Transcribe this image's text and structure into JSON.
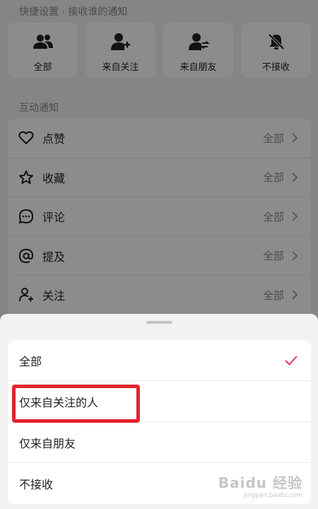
{
  "quick_settings": {
    "title": "快捷设置 · 接收谁的通知",
    "cards": [
      {
        "label": "全部",
        "icon": "group-icon"
      },
      {
        "label": "来自关注",
        "icon": "user-plus-icon"
      },
      {
        "label": "来自朋友",
        "icon": "user-friends-icon"
      },
      {
        "label": "不接收",
        "icon": "bell-off-icon"
      }
    ]
  },
  "interaction": {
    "title": "互动通知",
    "rows": [
      {
        "label": "点赞",
        "value": "全部",
        "icon": "heart-icon"
      },
      {
        "label": "收藏",
        "value": "全部",
        "icon": "star-icon"
      },
      {
        "label": "评论",
        "value": "全部",
        "icon": "comment-icon"
      },
      {
        "label": "提及",
        "value": "全部",
        "icon": "at-icon"
      },
      {
        "label": "关注",
        "value": "全部",
        "icon": "follow-icon"
      }
    ]
  },
  "sheet": {
    "options": [
      {
        "label": "全部",
        "selected": true
      },
      {
        "label": "仅来自关注的人",
        "selected": false
      },
      {
        "label": "仅来自朋友",
        "selected": false
      },
      {
        "label": "不接收",
        "selected": false
      }
    ],
    "check_color": "#e8385a"
  },
  "highlight_color": "#e3232f",
  "watermark": {
    "text": "Baidu 经验",
    "sub": "jingyan.baidu.com"
  }
}
